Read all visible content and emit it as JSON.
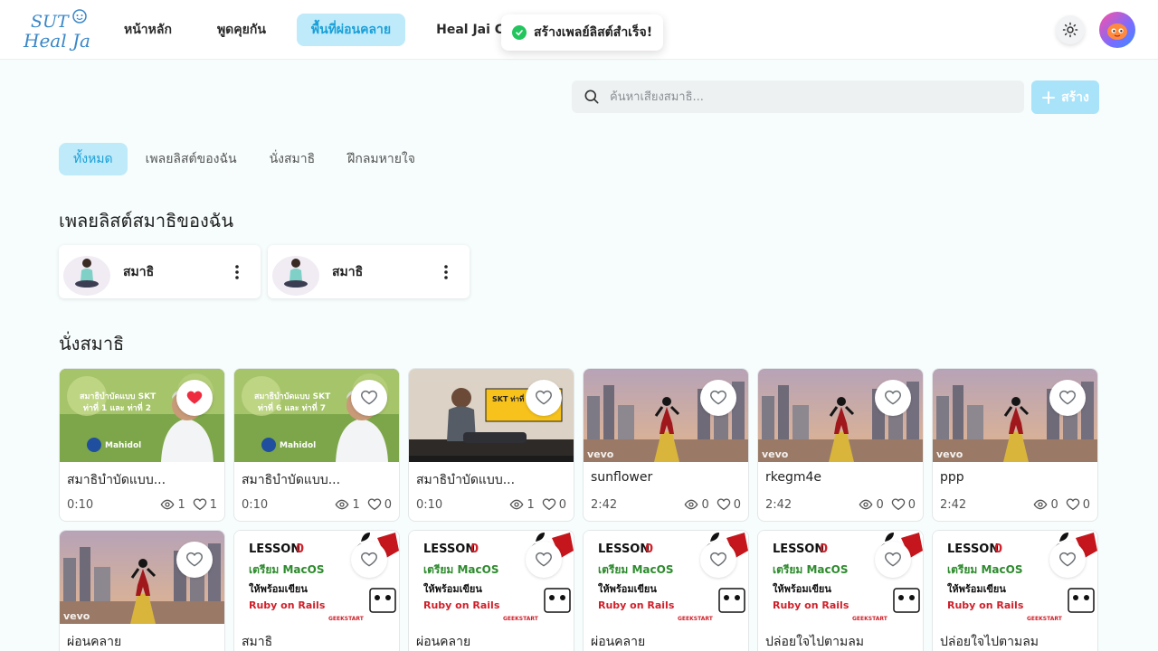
{
  "logo": {
    "line1": "SUT",
    "line2": "Heal Jai"
  },
  "nav": [
    {
      "label": "หน้าหลัก",
      "active": false
    },
    {
      "label": "พูดคุยกัน",
      "active": false
    },
    {
      "label": "พื้นที่ผ่อนคลาย",
      "active": true
    },
    {
      "label": "Heal Jai Ca",
      "active": false
    }
  ],
  "toast": {
    "message": "สร้างเพลย์ลิสต์สำเร็จ!"
  },
  "search": {
    "placeholder": "ค้นหาเสียงสมาธิ..."
  },
  "create_button": {
    "label": "สร้าง"
  },
  "tabs": [
    {
      "label": "ทั้งหมด",
      "active": true
    },
    {
      "label": "เพลยลิสต์ของฉัน",
      "active": false
    },
    {
      "label": "นั่งสมาธิ",
      "active": false
    },
    {
      "label": "ฝึกลมหายใจ",
      "active": false
    }
  ],
  "sections": {
    "my_playlists": "เพลยลิสต์สมาธิของฉัน",
    "meditation": "นั่งสมาธิ"
  },
  "playlists": [
    {
      "name": "สมาธิ"
    },
    {
      "name": "สมาธิ"
    }
  ],
  "media": [
    {
      "title": "สมาธิบำบัดแบบ...",
      "duration": "0:10",
      "views": "1",
      "likes": "1",
      "favorited": true,
      "thumb": "mahidol1"
    },
    {
      "title": "สมาธิบำบัดแบบ...",
      "duration": "0:10",
      "views": "1",
      "likes": "0",
      "favorited": false,
      "thumb": "mahidol2"
    },
    {
      "title": "สมาธิบำบัดแบบ...",
      "duration": "0:10",
      "views": "1",
      "likes": "0",
      "favorited": false,
      "thumb": "skt"
    },
    {
      "title": "sunflower",
      "duration": "2:42",
      "views": "0",
      "likes": "0",
      "favorited": false,
      "thumb": "city"
    },
    {
      "title": "rkegm4e",
      "duration": "2:42",
      "views": "0",
      "likes": "0",
      "favorited": false,
      "thumb": "city"
    },
    {
      "title": "ppp",
      "duration": "2:42",
      "views": "0",
      "likes": "0",
      "favorited": false,
      "thumb": "city"
    },
    {
      "title": "ผ่อนคลาย",
      "favorited": false,
      "thumb": "city"
    },
    {
      "title": "สมาธิ",
      "favorited": false,
      "thumb": "lesson"
    },
    {
      "title": "ผ่อนคลาย",
      "favorited": false,
      "thumb": "lesson"
    },
    {
      "title": "ผ่อนคลาย",
      "favorited": false,
      "thumb": "lesson"
    },
    {
      "title": "ปล่อยใจไปตามลม",
      "favorited": false,
      "thumb": "lesson"
    },
    {
      "title": "ปล่อยใจไปตามลม",
      "favorited": false,
      "thumb": "lesson"
    }
  ],
  "thumb_text": {
    "mahidol_title": "สมาธิบำบัดแบบ SKT",
    "mahidol1_sub": "ท่าที่ 1 และ ท่าที่ 2",
    "mahidol2_sub": "ท่าที่ 6 และ ท่าที่ 7",
    "mahidol_brand": "Mahidol",
    "skt_sign": "SKT ท่าที่ 3",
    "vevo": "vevo",
    "lesson_l1": "LESSON",
    "lesson_num": "0",
    "lesson_l2": "เตรียม MacOS",
    "lesson_l3": "ให้พร้อมเขียน",
    "lesson_l4": "Ruby on Rails",
    "lesson_brand": "GEEKSTART"
  },
  "colors": {
    "accent": "#1aa0d8",
    "accent_bg": "#bfeafa",
    "favorite": "#ef2b3f",
    "success": "#22c55e"
  }
}
